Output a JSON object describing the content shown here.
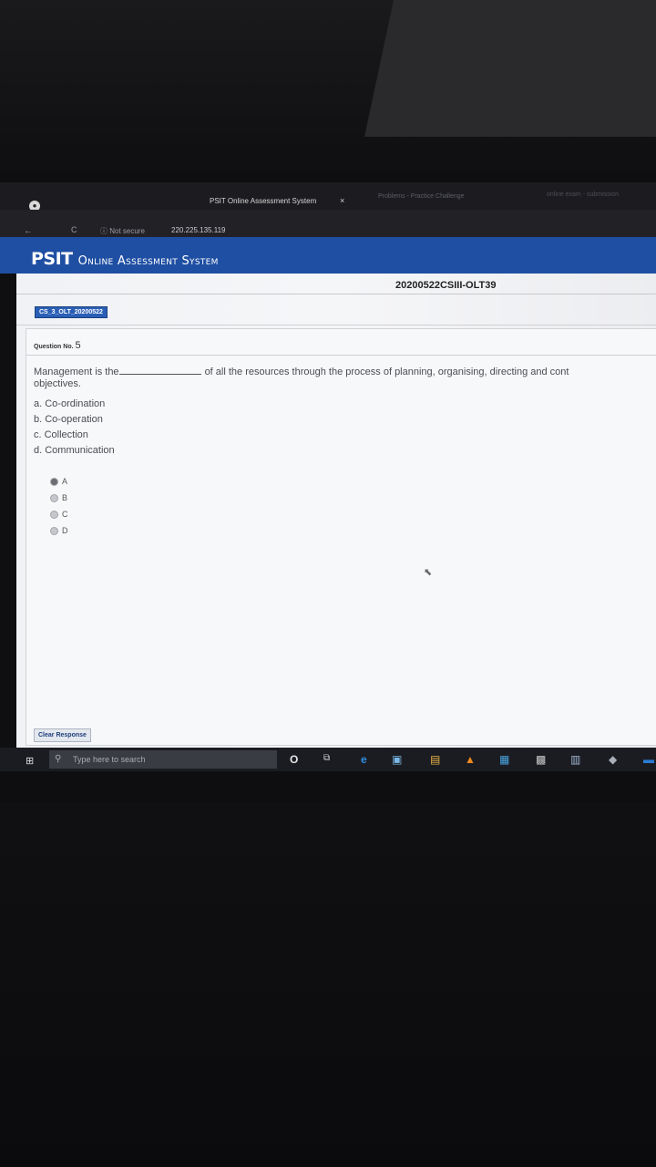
{
  "browser": {
    "tab_title": "PSIT Online Assessment System",
    "tab_close": "×",
    "tab2_title": "Problems - Practice Challenge",
    "tab3_title": "online exam - submission",
    "not_secure": "Not secure",
    "url": "220.225.135.119"
  },
  "header": {
    "brand_psit": "PSIT",
    "brand_rest": "Online Assessment System"
  },
  "exam": {
    "code": "20200522CSIII-OLT39",
    "test_tag": "CS_3_OLT_20200522"
  },
  "question": {
    "label": "Question No.",
    "number": "5",
    "text_part1": "Management is the",
    "text_part2": "of all the resources through the process of planning, organising, directing and cont",
    "text_line2": "objectives.",
    "options": [
      "a. Co-ordination",
      "b. Co-operation",
      "c. Collection",
      "d. Communication"
    ],
    "answers": [
      "A",
      "B",
      "C",
      "D"
    ],
    "selected": "A"
  },
  "actions": {
    "clear_response": "Clear Response"
  },
  "taskbar": {
    "search_placeholder": "Type here to search"
  },
  "icons": {
    "browser": "browser-logo-icon",
    "back": "back-arrow-icon",
    "reload": "reload-icon",
    "info": "info-icon",
    "start": "windows-start-icon",
    "search": "search-icon",
    "cortana": "cortana-icon",
    "task_view": "task-view-icon",
    "edge": "edge-icon",
    "cursor": "mouse-cursor-icon"
  }
}
